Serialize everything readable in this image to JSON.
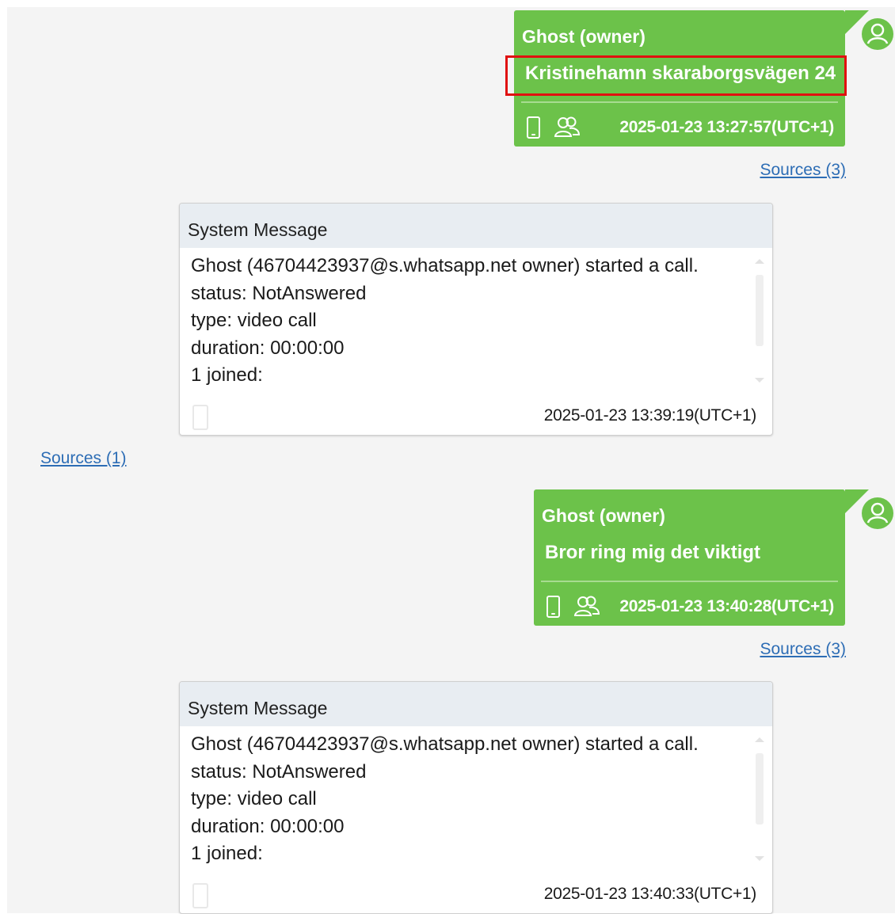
{
  "messages": [
    {
      "sender": "Ghost (owner)",
      "text": "Kristinehamn skaraborgsvägen 24",
      "timestamp": "2025-01-23 13:27:57(UTC+1)",
      "sources": "Sources (3)"
    },
    {
      "system_title": "System Message",
      "lines": [
        "Ghost (46704423937@s.whatsapp.net owner) started a call.",
        "status: NotAnswered",
        "type: video call",
        "duration: 00:00:00",
        "1 joined:"
      ],
      "timestamp": "2025-01-23 13:39:19(UTC+1)",
      "sources": "Sources (1)"
    },
    {
      "sender": "Ghost (owner)",
      "text": "Bror ring mig det viktigt",
      "timestamp": "2025-01-23 13:40:28(UTC+1)",
      "sources": "Sources (3)"
    },
    {
      "system_title": "System Message",
      "lines": [
        "Ghost (46704423937@s.whatsapp.net owner) started a call.",
        "status: NotAnswered",
        "type: video call",
        "duration: 00:00:00",
        "1 joined:"
      ],
      "timestamp": "2025-01-23 13:40:33(UTC+1)"
    }
  ],
  "colors": {
    "outgoing_bubble": "#6cc24a",
    "system_header": "#e8edf2",
    "link": "#2d6db5",
    "highlight_box": "#e01010"
  },
  "icons": {
    "avatar": "user-avatar-icon",
    "device": "phone-icon",
    "chat_type": "group-chat-icon"
  }
}
